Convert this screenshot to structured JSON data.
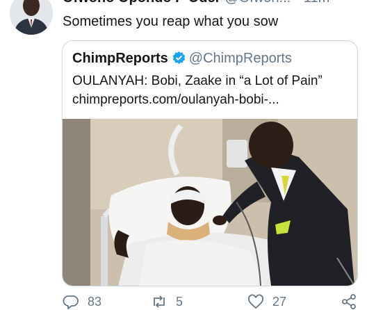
{
  "tweet": {
    "author_name": "Ofwono Opondo P Oder",
    "author_handle": "@Ofwon...",
    "separator": "·",
    "time": "11m",
    "text": "Sometimes you reap what you sow"
  },
  "quoted_tweet": {
    "author_name": "ChimpReports",
    "author_handle": "@ChimpReports",
    "verified": true,
    "headline": "OULANYAH: Bobi, Zaake in “a Lot of Pain”",
    "link": "chimpreports.com/oulanyah-bobi-..."
  },
  "actions": {
    "replies": "83",
    "retweets": "5",
    "likes": "27"
  },
  "colors": {
    "text": "#14171a",
    "muted": "#657786",
    "border": "#ccd6dd",
    "verified_blue": "#1da1f2",
    "background": "#ffffff"
  },
  "icons": [
    "chevron-down-icon",
    "verified-badge-icon",
    "reply-icon",
    "retweet-icon",
    "like-icon",
    "share-icon"
  ]
}
